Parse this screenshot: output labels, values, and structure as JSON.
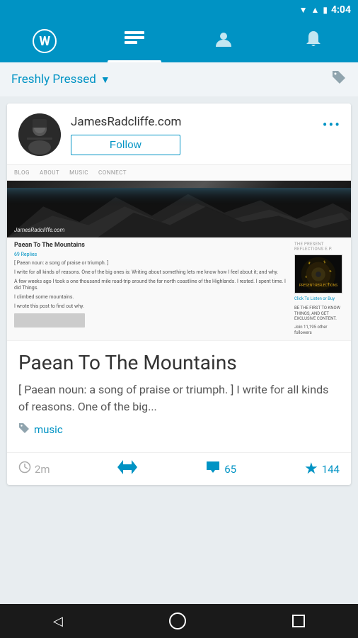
{
  "statusBar": {
    "time": "4:04",
    "batteryIcon": "🔋",
    "signalIcon": "▲"
  },
  "navBar": {
    "items": [
      {
        "id": "wordpress",
        "label": "WordPress",
        "icon": "W",
        "active": false
      },
      {
        "id": "reader",
        "label": "Reader",
        "icon": "☰",
        "active": true
      },
      {
        "id": "profile",
        "label": "Profile",
        "icon": "👤",
        "active": false
      },
      {
        "id": "notifications",
        "label": "Notifications",
        "icon": "🔔",
        "active": false
      }
    ]
  },
  "header": {
    "title": "Freshly Pressed",
    "dropdownIcon": "▼",
    "tagIcon": "🏷"
  },
  "blogCard": {
    "blogName": "JamesRadcliffe.com",
    "followLabel": "Follow",
    "moreDotsLabel": "•••",
    "preview": {
      "navItems": [
        "BLOG",
        "ABOUT",
        "MUSIC",
        "CONNECT"
      ],
      "heroText": "JamesRadcliffe.com",
      "articleTitle": "Paean To The Mountains",
      "repliesLabel": "69 Replies",
      "bodyText1": "[ Paean noun: a song of praise or triumph. ]",
      "bodyText2": "I write for all kinds of reasons. One of the big ones is: Writing about something lets me know how I feel about it; and why.",
      "bodyText3": "A few weeks ago I took a one thousand mile road-trip around the far north coastline of the Highlands. I rested. I spent time. I did Things.",
      "bodyText4": "I climbed some mountains.",
      "bodyText5": "I wrote this post to find out why.",
      "sideTitle": "THE PRESENT REFLECTIONS E.P.",
      "albumText": "PRESENT:REFLECTIONS",
      "sideSubText": "Click To Listen or Buy",
      "sideFollowers": "BE THE FIRST TO KNOW THINGS, AND GET EXCLUSIVE CONTENT.",
      "sideFollowerCount": "Join 11,195 other followers"
    }
  },
  "post": {
    "title": "Paean To The Mountains",
    "excerpt": "[ Paean noun: a song of praise or triumph. ] I write for all kinds of reasons.  One of the big...",
    "tagIcon": "🏷",
    "tagLabel": "music"
  },
  "postFooter": {
    "timeIcon": "🕐",
    "timeLabel": "2m",
    "reblogIcon": "↕",
    "commentsIcon": "💬",
    "commentsCount": "65",
    "starIcon": "★",
    "starCount": "144"
  },
  "systemBar": {
    "backIcon": "◁",
    "homeIcon": "○",
    "recentIcon": "□"
  }
}
